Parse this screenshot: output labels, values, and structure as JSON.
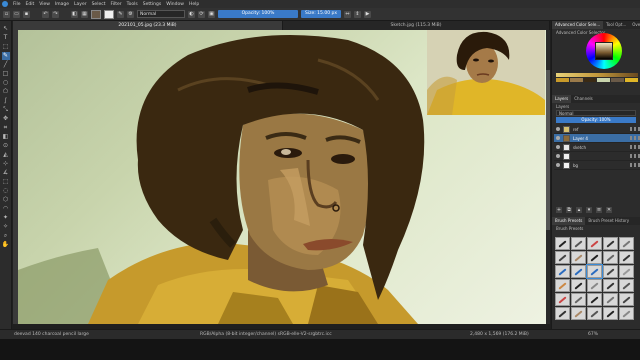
{
  "menu": [
    "File",
    "Edit",
    "View",
    "Image",
    "Layer",
    "Select",
    "Filter",
    "Tools",
    "Settings",
    "Window",
    "Help"
  ],
  "toolbar": {
    "blend_mode": "Normal",
    "opacity_label": "Opacity: 100%",
    "size_label": "Size: 15.00 px"
  },
  "tabs": [
    {
      "label": "202101_05.jpg (23.3 MiB)",
      "active": true
    },
    {
      "label": "Sketch.jpg (115.3 MiB)",
      "active": false
    }
  ],
  "dock": {
    "top_tabs": [
      "Advanced Color Sele...",
      "Tool Opt...",
      "Over..."
    ],
    "selector_title": "Advanced Color Selector",
    "layer_tabs": [
      "Layers",
      "Channels"
    ],
    "layers_title": "Layers",
    "layer_blend": "Normal",
    "layer_opacity": "Opacity: 100%",
    "layers": [
      {
        "name": "ref",
        "active": false,
        "color": "#d6c070"
      },
      {
        "name": "Layer 4",
        "active": true,
        "color": "#8a6a3a"
      },
      {
        "name": "sketch",
        "active": false,
        "color": "#e8e8e8"
      },
      {
        "name": "",
        "active": false,
        "color": "#f0f0f0"
      },
      {
        "name": "bg",
        "active": false,
        "color": "#f2f2f2"
      }
    ],
    "brush_tabs": [
      "Brush Presets",
      "Brush Preset History"
    ],
    "brush_title": "Brush Presets"
  },
  "status": {
    "brush": "deevad 140 charcoal pencil large",
    "color_space": "RGB/Alpha (8-bit integer/channel) sRGB-elle-V2-srgbtrc.icc",
    "dimensions": "2,480 x 1,569 (176.2 MiB)",
    "zoom": "67%"
  },
  "colors": {
    "accent": "#3a7ac8",
    "hair": "#3a2a14",
    "shirt": "#c89a2a",
    "skin": "#9a7a4a"
  }
}
